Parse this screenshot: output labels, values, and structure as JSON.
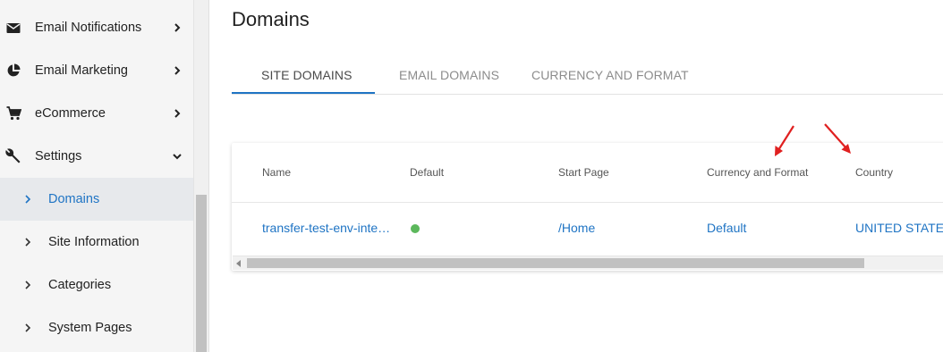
{
  "sidebar": {
    "items": [
      {
        "label": "Email Notifications",
        "icon": "envelope-icon"
      },
      {
        "label": "Email Marketing",
        "icon": "pie-chart-icon"
      },
      {
        "label": "eCommerce",
        "icon": "shopping-cart-icon"
      },
      {
        "label": "Settings",
        "icon": "wrench-icon",
        "expanded": true
      }
    ],
    "sub_items": [
      {
        "label": "Domains",
        "active": true
      },
      {
        "label": "Site Information"
      },
      {
        "label": "Categories"
      },
      {
        "label": "System Pages"
      }
    ]
  },
  "page": {
    "title": "Domains"
  },
  "tabs": [
    {
      "label": "SITE DOMAINS",
      "active": true
    },
    {
      "label": "EMAIL DOMAINS"
    },
    {
      "label": "CURRENCY AND FORMAT"
    }
  ],
  "table": {
    "columns": [
      "Name",
      "Default",
      "Start Page",
      "Currency and Format",
      "Country"
    ],
    "rows": [
      {
        "name": "transfer-test-env-inte…",
        "default": true,
        "start_page": "/Home",
        "currency_format": "Default",
        "country": "UNITED STATES"
      }
    ]
  },
  "colors": {
    "accent": "#1f74c4",
    "default_dot": "#5cb85c",
    "annotation_arrow": "#e02020"
  }
}
